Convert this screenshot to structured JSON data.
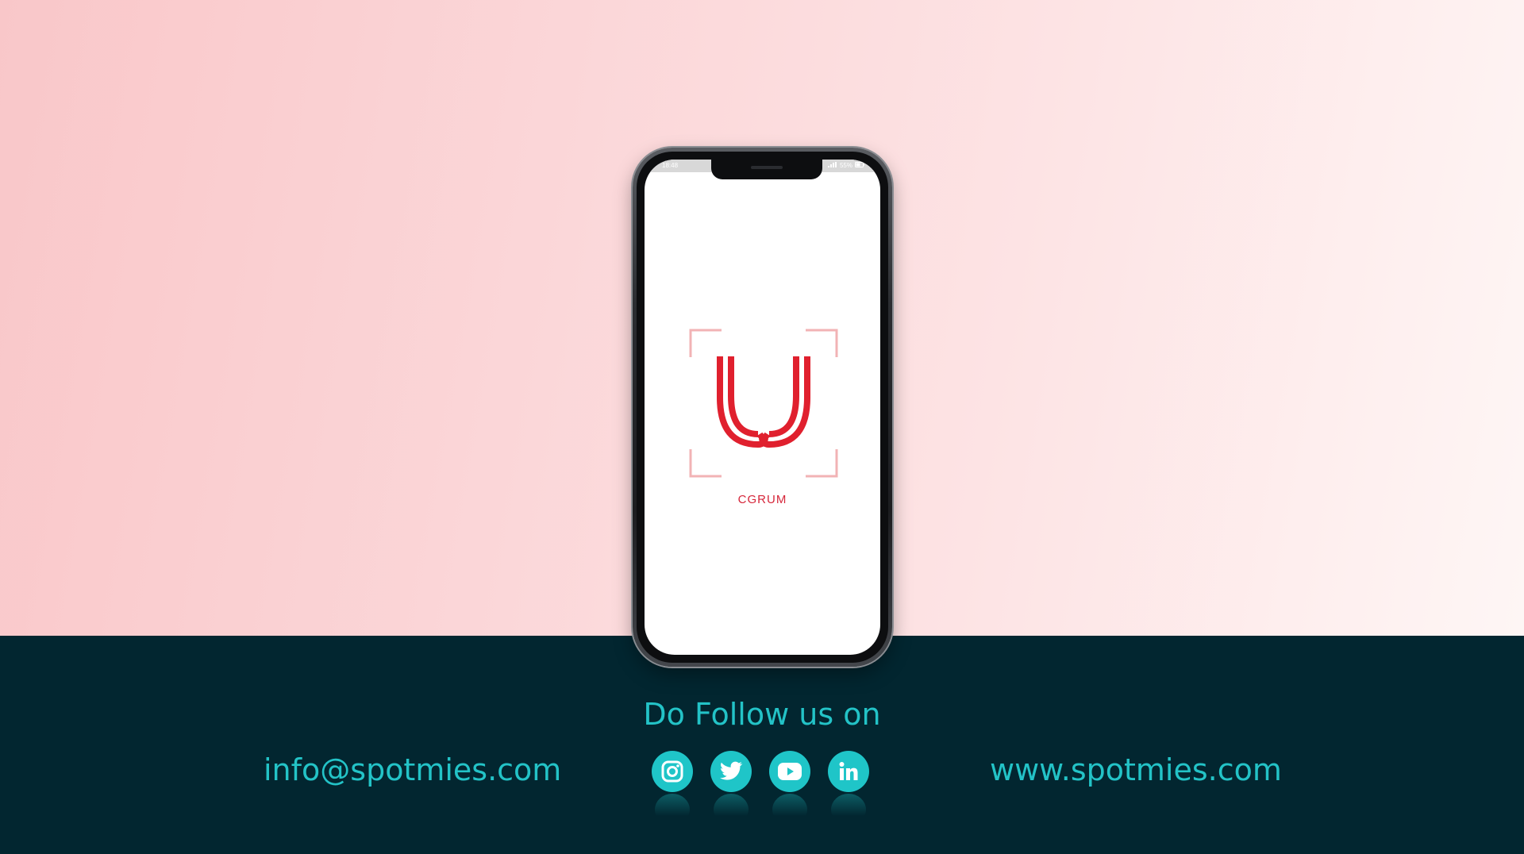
{
  "phone": {
    "status_time": "18:48",
    "status_battery": "55%",
    "app_name": "CGRUM"
  },
  "footer": {
    "follow_title": "Do Follow us on",
    "email": "info@spotmies.com",
    "website": "www.spotmies.com",
    "social_links": [
      {
        "icon": "instagram-icon"
      },
      {
        "icon": "twitter-icon"
      },
      {
        "icon": "youtube-icon"
      },
      {
        "icon": "linkedin-icon"
      }
    ]
  },
  "colors": {
    "accent": "#23c3c7",
    "footer_bg": "#022630",
    "logo_red": "#e0202e",
    "frame_pink": "#f2b3b5"
  }
}
